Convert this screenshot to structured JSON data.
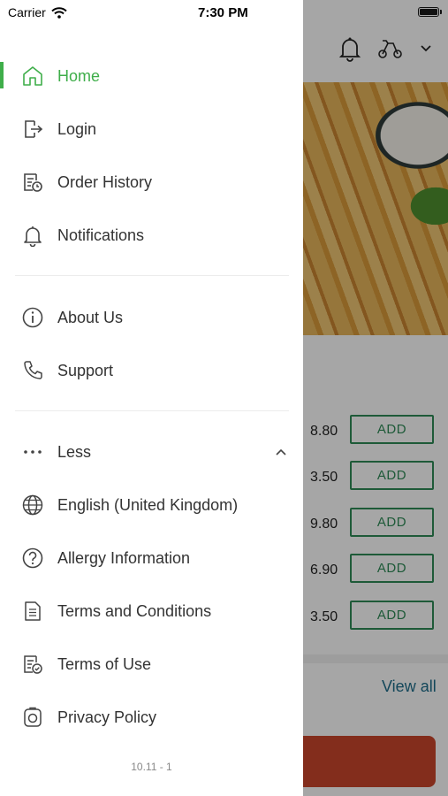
{
  "status_bar": {
    "carrier": "Carrier",
    "time": "7:30 PM"
  },
  "menu": {
    "items_primary": [
      {
        "label": "Home",
        "icon": "home-icon",
        "active": true
      },
      {
        "label": "Login",
        "icon": "login-icon"
      },
      {
        "label": "Order History",
        "icon": "order-history-icon"
      },
      {
        "label": "Notifications",
        "icon": "bell-icon"
      }
    ],
    "items_secondary": [
      {
        "label": "About Us",
        "icon": "info-icon"
      },
      {
        "label": "Support",
        "icon": "phone-icon"
      }
    ],
    "less_toggle": {
      "label": "Less",
      "icon": "more-dots-icon"
    },
    "items_more": [
      {
        "label": "English (United Kingdom)",
        "icon": "globe-icon"
      },
      {
        "label": "Allergy Information",
        "icon": "question-icon"
      },
      {
        "label": "Terms and Conditions",
        "icon": "document-icon"
      },
      {
        "label": "Terms of Use",
        "icon": "document-check-icon"
      },
      {
        "label": "Privacy Policy",
        "icon": "privacy-icon"
      }
    ],
    "version": "10.11 - 1",
    "accent_color": "#3fae4a"
  },
  "background": {
    "prices": [
      "8.80",
      "3.50",
      "9.80",
      "6.90",
      "3.50"
    ],
    "add_label": "ADD",
    "view_all": "View all"
  }
}
